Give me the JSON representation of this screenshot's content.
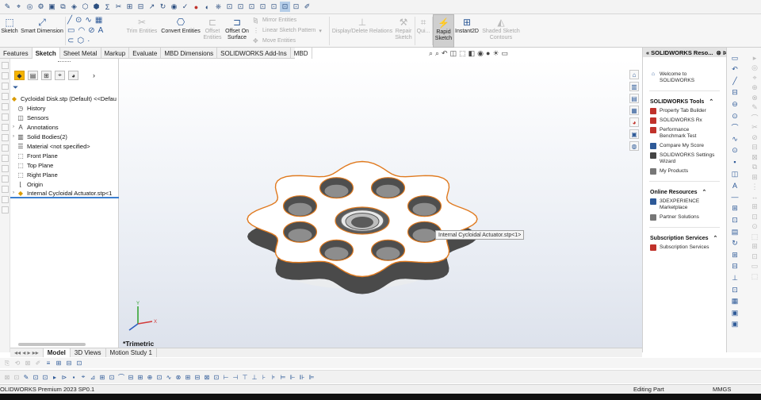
{
  "ribbon": {
    "sketch": "Sketch",
    "smart_dimension": "Smart Dimension",
    "trim_entities": "Trim Entities",
    "convert_entities": "Convert Entities",
    "offset_entities": "Offset\nEntities",
    "offset_on_surface": "Offset On\nSurface",
    "mirror_entities": "Mirror Entities",
    "linear_sketch_pattern": "Linear Sketch Pattern",
    "move_entities": "Move Entities",
    "display_delete_relations": "Display/Delete Relations",
    "repair_sketch": "Repair\nSketch",
    "quick_snaps": "Qui...",
    "rapid_sketch": "Rapid\nSketch",
    "instant2d": "Instant2D",
    "shaded_sketch_contours": "Shaded Sketch\nContours"
  },
  "command_tabs": [
    "Features",
    "Sketch",
    "Sheet Metal",
    "Markup",
    "Evaluate",
    "MBD Dimensions",
    "SOLIDWORKS Add-Ins",
    "MBD"
  ],
  "active_command_tab": "Sketch",
  "feature_tree": {
    "root": "Cycloidal Disk.stp (Default) <<Defau",
    "items": [
      {
        "label": "History",
        "icon": "history-icon",
        "expand": false
      },
      {
        "label": "Sensors",
        "icon": "sensors-icon",
        "expand": false
      },
      {
        "label": "Annotations",
        "icon": "annotations-icon",
        "expand": true
      },
      {
        "label": "Solid Bodies(2)",
        "icon": "solid-bodies-icon",
        "expand": true
      },
      {
        "label": "Material <not specified>",
        "icon": "material-icon",
        "expand": false
      },
      {
        "label": "Front Plane",
        "icon": "plane-icon",
        "expand": false
      },
      {
        "label": "Top Plane",
        "icon": "plane-icon",
        "expand": false
      },
      {
        "label": "Right Plane",
        "icon": "plane-icon",
        "expand": false
      },
      {
        "label": "Origin",
        "icon": "origin-icon",
        "expand": false
      },
      {
        "label": "Internal Cycloidal Actuator.stp<1",
        "icon": "part-icon",
        "expand": true
      }
    ]
  },
  "viewport": {
    "tooltip": "Internal Cycloidal Actuator.stp<1>",
    "view_label": "*Trimetric"
  },
  "task_pane": {
    "title": "SOLIDWORKS Reso...",
    "welcome": "Welcome to\nSOLIDWORKS",
    "tools_header": "SOLIDWORKS Tools",
    "tools": [
      "Property Tab Builder",
      "SOLIDWORKS Rx",
      "Performance\nBenchmark Test",
      "Compare My Score",
      "SOLIDWORKS Settings\nWizard",
      "My Products"
    ],
    "online_header": "Online Resources",
    "online": [
      "3DEXPERIENCE\nMarketplace",
      "Partner Solutions"
    ],
    "subscription_header": "Subscription Services",
    "subscription": [
      "Subscription Services"
    ]
  },
  "bottom_tabs": [
    "Model",
    "3D Views",
    "Motion Study 1"
  ],
  "active_bottom_tab": "Model",
  "status": {
    "app": "OLIDWORKS Premium 2023 SP0.1",
    "mode": "Editing Part",
    "units": "MMGS"
  },
  "colors": {
    "accent": "#2e5a98",
    "edge": "#e07a1f",
    "tree_underline": "#3b7fd0"
  }
}
